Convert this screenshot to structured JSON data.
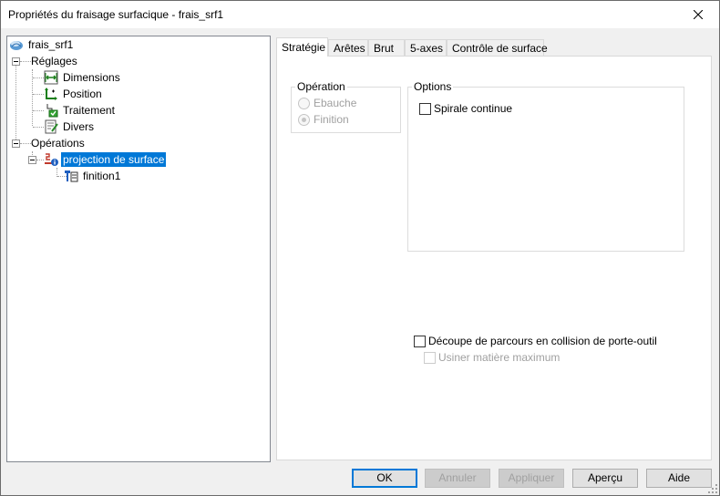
{
  "window": {
    "title": "Propriétés du fraisage surfacique - frais_srf1",
    "close_icon": "close-icon"
  },
  "tree": {
    "root": {
      "label": "frais_srf1",
      "icon": "surface-mill-icon"
    },
    "reglages": {
      "label": "Réglages",
      "children": [
        {
          "label": "Dimensions",
          "icon": "dimensions-icon"
        },
        {
          "label": "Position",
          "icon": "position-icon"
        },
        {
          "label": "Traitement",
          "icon": "treatment-icon"
        },
        {
          "label": "Divers",
          "icon": "misc-icon"
        }
      ]
    },
    "operations": {
      "label": "Opérations"
    },
    "projection": {
      "label": "projection de surface",
      "icon": "projection-icon",
      "selected": true
    },
    "finition": {
      "label": "finition1",
      "icon": "tool-icon"
    }
  },
  "tabs": [
    {
      "label": "Stratégie",
      "active": true
    },
    {
      "label": "Arêtes"
    },
    {
      "label": "Brut"
    },
    {
      "label": "5-axes"
    },
    {
      "label": "Contrôle de surface"
    }
  ],
  "strategy": {
    "operation_legend": "Opération",
    "ebauche": {
      "label": "Ebauche",
      "checked": false,
      "enabled": false
    },
    "finition": {
      "label": "Finition",
      "checked": true,
      "enabled": false
    },
    "options_legend": "Options",
    "spirale": {
      "label": "Spirale continue",
      "checked": false
    },
    "decoupe": {
      "label": "Découpe de parcours en collision de porte-outil",
      "checked": false
    },
    "usiner": {
      "label": "Usiner matière maximum",
      "checked": false,
      "enabled": false
    }
  },
  "buttons": {
    "ok": "OK",
    "annuler": "Annuler",
    "appliquer": "Appliquer",
    "apercu": "Aperçu",
    "aide": "Aide"
  },
  "colors": {
    "selection": "#0078d7",
    "disabled_text": "#a0a0a0"
  }
}
